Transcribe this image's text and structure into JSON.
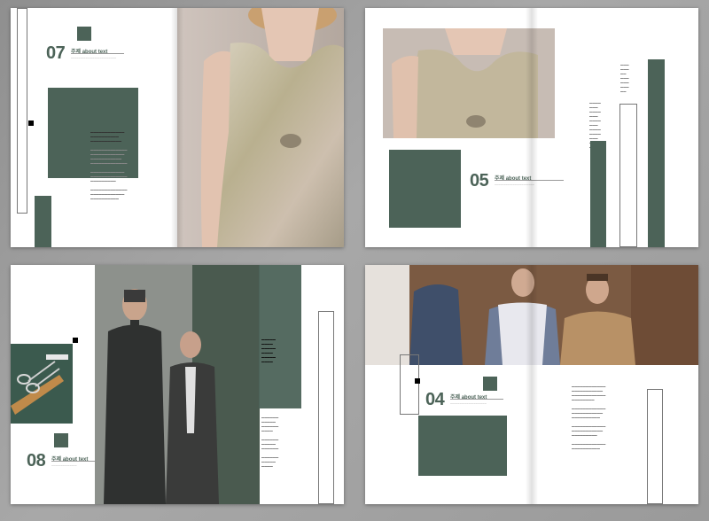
{
  "spreads": {
    "top_left": {
      "number": "07",
      "subtitle": "주제 about text"
    },
    "top_right": {
      "number": "05",
      "subtitle": "주제 about text"
    },
    "bottom_left": {
      "number": "08",
      "subtitle": "주제 about text"
    },
    "bottom_right": {
      "number": "04",
      "subtitle": "주제 about text"
    }
  },
  "colors": {
    "accent": "#4c6358",
    "page": "#ffffff",
    "background": "#9d9d9d"
  }
}
